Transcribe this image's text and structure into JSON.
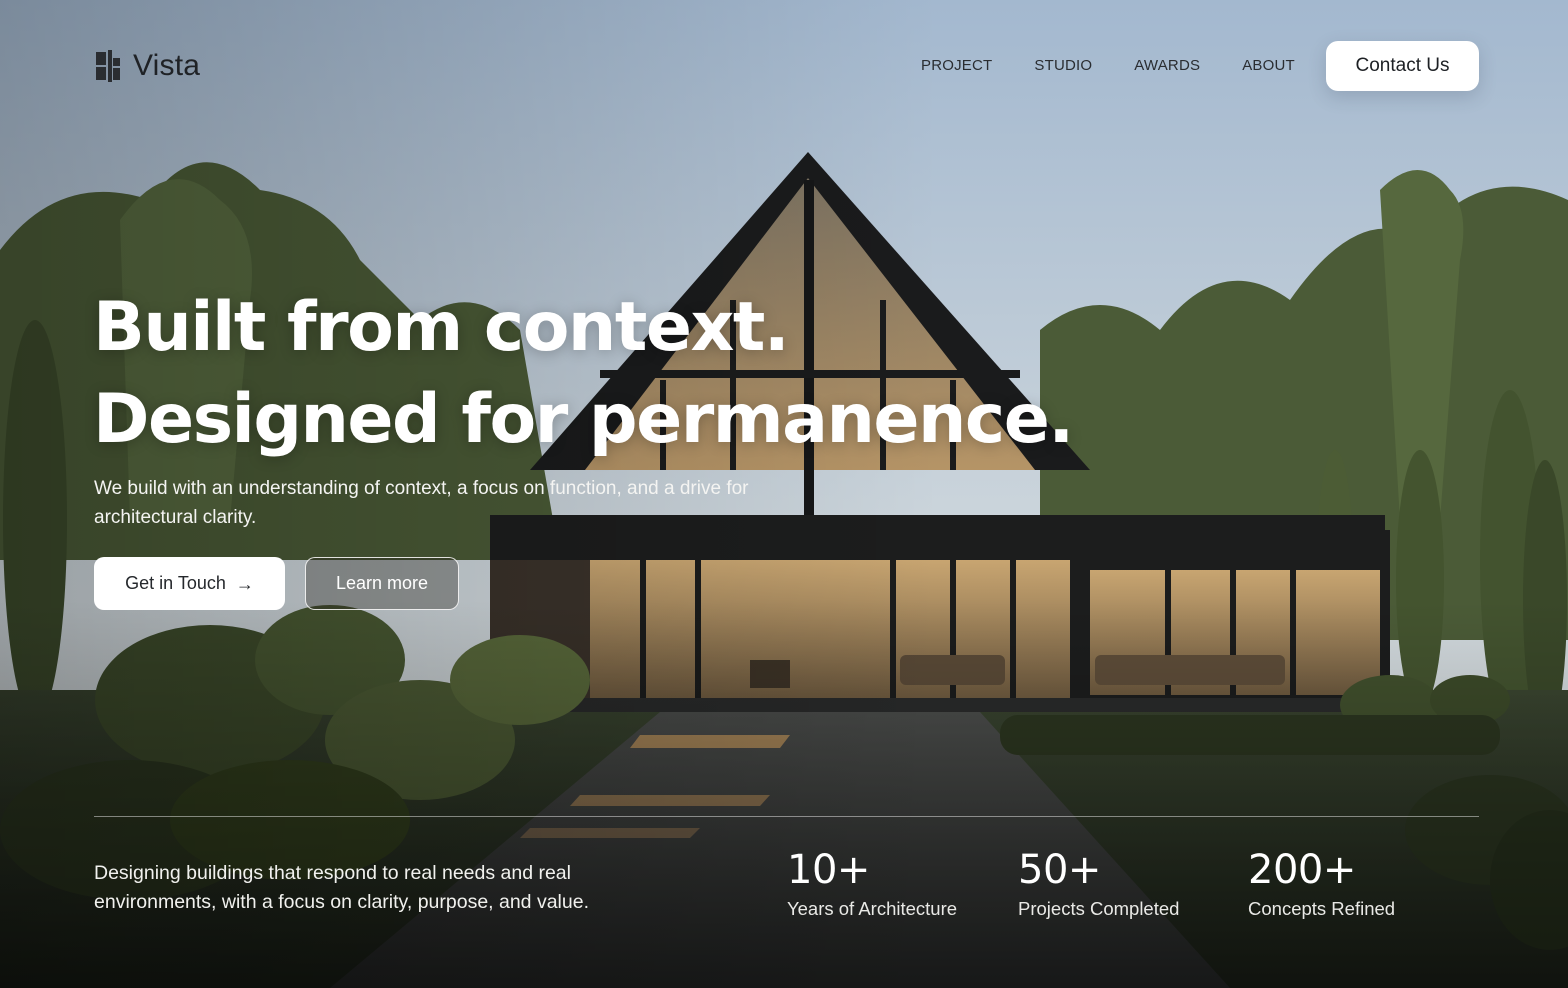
{
  "brand": {
    "name": "Vista",
    "icon": "building-logo-icon"
  },
  "nav": {
    "links": [
      "PROJECT",
      "STUDIO",
      "AWARDS",
      "ABOUT"
    ],
    "cta_label": "Contact Us"
  },
  "hero": {
    "headline_line1": "Built from context.",
    "headline_line2": "Designed for permanence.",
    "subtitle": "We build with an understanding of context, a focus on function, and a drive for architectural clarity.",
    "primary_button": "Get in Touch",
    "primary_button_icon": "arrow-right-icon",
    "secondary_button": "Learn more"
  },
  "footer_section": {
    "tagline": "Designing buildings that respond to real needs and real environments, with a focus on clarity, purpose, and value.",
    "stats": [
      {
        "value": "10+",
        "label": "Years of Architecture"
      },
      {
        "value": "50+",
        "label": "Projects Completed"
      },
      {
        "value": "200+",
        "label": "Concepts Refined"
      }
    ]
  },
  "colors": {
    "sky_top": "#a9bdd3",
    "sky_bottom": "#d7dde0",
    "foliage": "#3b4a2c",
    "house_frame": "#1b1c1d",
    "warm_light": "#c9a46d",
    "text_light": "#ffffff",
    "text_dark": "#1f2226"
  }
}
